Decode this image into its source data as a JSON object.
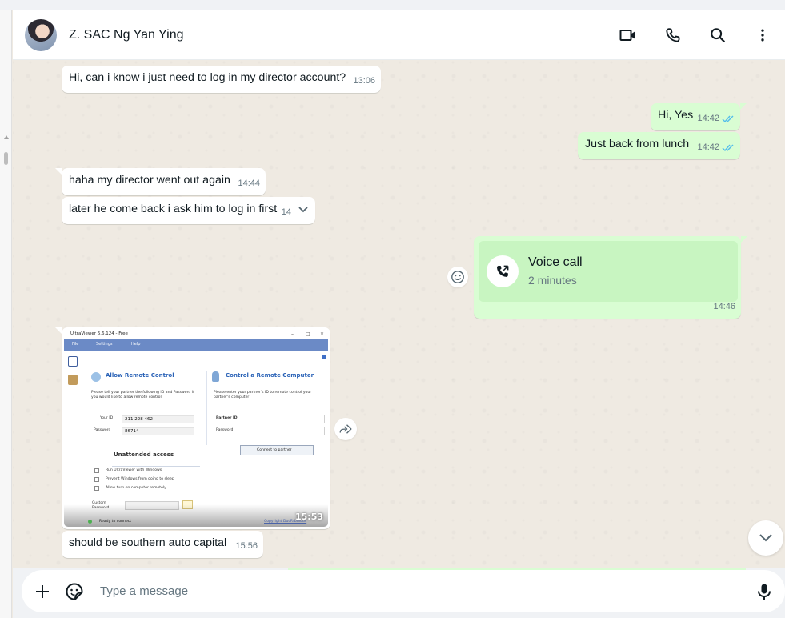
{
  "header": {
    "contact_name": "Z. SAC Ng Yan Ying",
    "icons": [
      "video-call-icon",
      "phone-icon",
      "search-icon",
      "menu-icon"
    ]
  },
  "messages": [
    {
      "direction": "in",
      "text": "Hi, can i know i just need to log in my director account?",
      "time": "13:06"
    },
    {
      "direction": "out",
      "text": "Hi, Yes",
      "time": "14:42",
      "status": "read"
    },
    {
      "direction": "out",
      "text": "Just back from lunch",
      "time": "14:42",
      "status": "read"
    },
    {
      "direction": "in",
      "text": "haha my director went out again",
      "time": "14:44"
    },
    {
      "direction": "in",
      "text": "later he come back i ask him to log in first",
      "time": "14"
    },
    {
      "direction": "out",
      "type": "call",
      "title": "Voice call",
      "subtitle": "2 minutes",
      "time": "14:46"
    },
    {
      "direction": "in",
      "type": "image",
      "time": "15:53"
    },
    {
      "direction": "in",
      "text": "should be southern auto capital",
      "time": "15:56"
    }
  ],
  "screenshot_image": {
    "window_title": "UltraViewer 6.6.124 - Free",
    "menu": [
      "File",
      "Settings",
      "Help"
    ],
    "left_panel": {
      "title": "Allow Remote Control",
      "desc": "Please tell your partner the following ID and Password if you would like to allow remote control",
      "id_label": "Your ID",
      "id_value": "211 228 462",
      "pw_label": "Password",
      "pw_value": "86714"
    },
    "right_panel": {
      "title": "Control a Remote Computer",
      "desc": "Please enter your partner's ID to remote control your partner's computer",
      "partner_label": "Partner ID",
      "pw_label": "Password",
      "connect_button": "Connect to partner"
    },
    "unattended": {
      "title": "Unattended access",
      "options": [
        "Run UltraViewer with Windows",
        "Prevent Windows from going to sleep",
        "Allow turn on computer remotely"
      ],
      "custom_label": "Custom Password"
    },
    "status": "Ready to connect",
    "copyright": "Copyright DucFabulous"
  },
  "composer": {
    "placeholder": "Type a message"
  },
  "colors": {
    "outgoing_bubble": "#d9fdd3",
    "incoming_bubble": "#ffffff",
    "chat_bg": "#efeae2",
    "read_ticks": "#53bdeb"
  }
}
